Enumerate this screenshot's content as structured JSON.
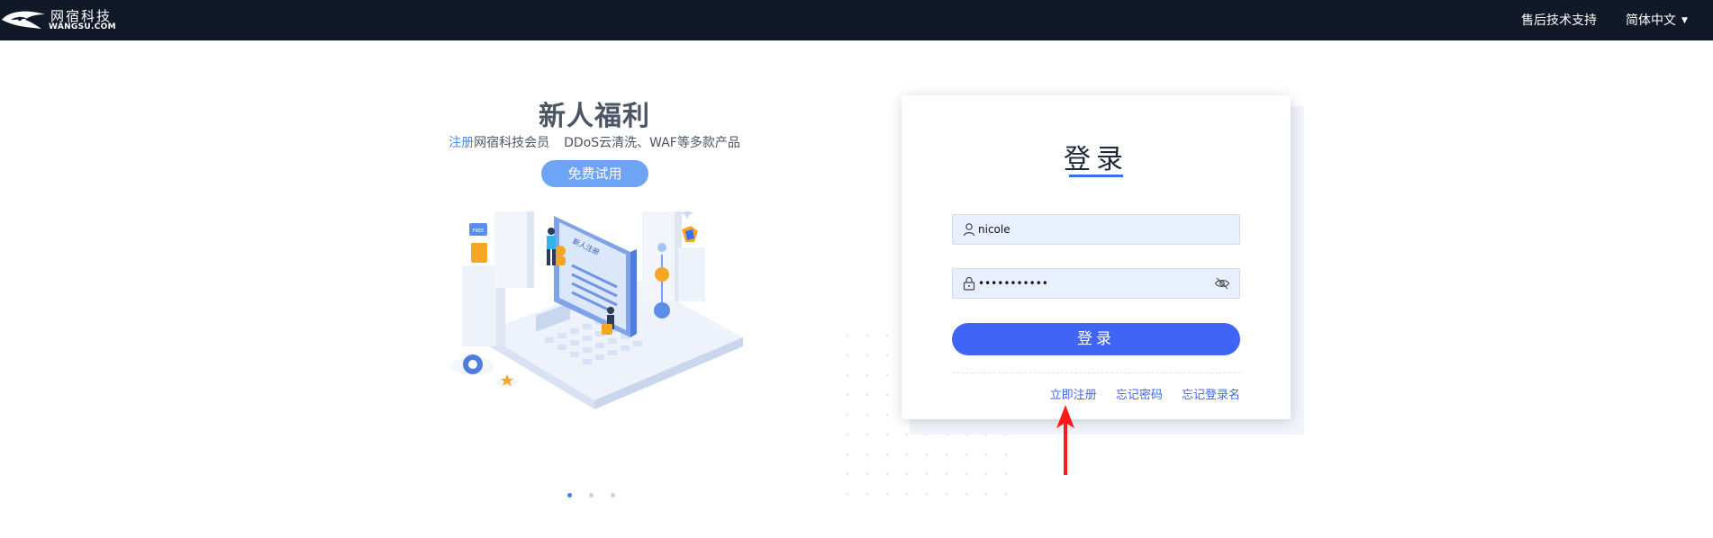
{
  "header": {
    "logo_cn": "网宿科技",
    "logo_en": "WANGSU.COM",
    "support_label": "售后技术支持",
    "language_label": "简体中文"
  },
  "promo": {
    "title": "新人福利",
    "subtitle_link": "注册",
    "subtitle_rest": "网宿科技会员",
    "subtitle_products": "DDoS云清洗、WAF等多款产品",
    "trial_button": "免费试用",
    "illustration_screen_text": "新人注册",
    "illustration_tag_free": "FREE",
    "carousel_count": 3,
    "carousel_active": 1
  },
  "login": {
    "title": "登录",
    "username_value": "nicole",
    "password_value": "•••••••••••",
    "login_button": "登录",
    "links": {
      "register": "立即注册",
      "forgot_password": "忘记密码",
      "forgot_username": "忘记登录名"
    }
  },
  "colors": {
    "topbar": "#111827",
    "accent": "#4065f6",
    "trial_button": "#6ea4f5",
    "arrow": "#ff1a1a"
  },
  "icons": {
    "logo": "wangsu-logo",
    "user_field": "user-icon",
    "password_field": "lock-icon",
    "password_toggle": "eye-slash-icon",
    "annotation": "red-arrow-icon"
  }
}
